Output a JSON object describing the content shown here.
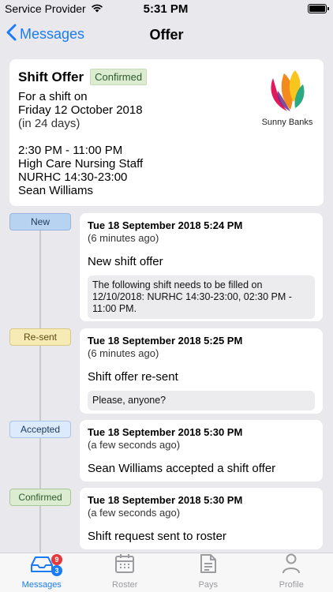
{
  "status_bar": {
    "carrier": "Service Provider",
    "time": "5:31 PM"
  },
  "nav": {
    "back_label": "Messages",
    "title": "Offer"
  },
  "offer": {
    "title": "Shift Offer",
    "status": "Confirmed",
    "line1": "For a shift on",
    "date": "Friday 12 October 2018",
    "relative": "(in 24 days)",
    "time_range": "2:30 PM - 11:00 PM",
    "role": "High Care Nursing Staff",
    "code": "NURHC 14:30-23:00",
    "person": "Sean Williams",
    "org_name": "Sunny Banks",
    "logo_colors": [
      "#e2195a",
      "#f28a1e",
      "#f7c51b",
      "#2ba884",
      "#6a2a8c"
    ]
  },
  "timeline": [
    {
      "label": "New",
      "date": "Tue 18 September 2018 5:24 PM",
      "ago": "(6 minutes ago)",
      "title": "New shift offer",
      "note": "The following shift needs to be filled on 12/10/2018: NURHC 14:30-23:00, 02:30 PM - 11:00 PM."
    },
    {
      "label": "Re-sent",
      "date": "Tue 18 September 2018 5:25 PM",
      "ago": "(6 minutes ago)",
      "title": "Shift offer re-sent",
      "note": "Please, anyone?"
    },
    {
      "label": "Accepted",
      "date": "Tue 18 September 2018 5:30 PM",
      "ago": "(a few seconds ago)",
      "title": "Sean Williams accepted a shift offer"
    },
    {
      "label": "Confirmed",
      "date": "Tue 18 September 2018 5:30 PM",
      "ago": "(a few seconds ago)",
      "title": "Shift request sent to roster"
    }
  ],
  "tabs": [
    {
      "label": "Messages",
      "icon": "inbox-icon",
      "badge_red": "9",
      "badge_blue": "3"
    },
    {
      "label": "Roster",
      "icon": "calendar-icon"
    },
    {
      "label": "Pays",
      "icon": "document-icon"
    },
    {
      "label": "Profile",
      "icon": "person-icon"
    }
  ],
  "colors": {
    "accent": "#1a7cf4",
    "tab_inactive": "#9b9ba0"
  }
}
